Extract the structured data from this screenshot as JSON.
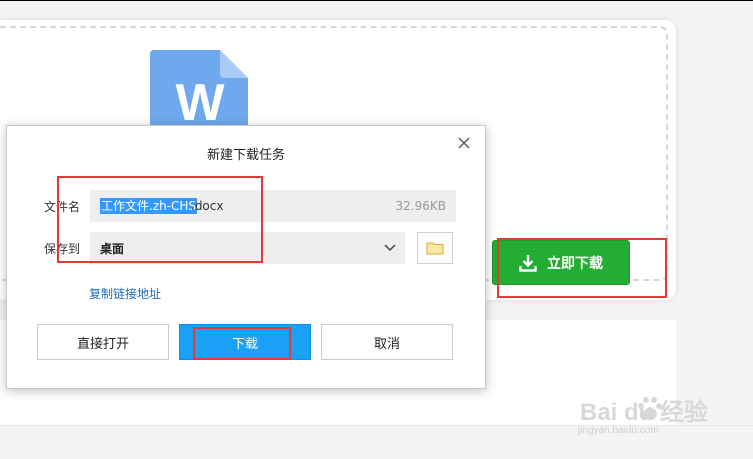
{
  "background": {
    "file_icon_letter": "W",
    "download_now_button": "立即下载"
  },
  "dialog": {
    "title": "新建下载任务",
    "filename_label": "文件名",
    "filename_selected": "工作文件.zh-CHS",
    "filename_extension": ".docx",
    "file_size": "32.96KB",
    "save_to_label": "保存到",
    "save_to_value": "桌面",
    "copy_link": "复制链接地址",
    "buttons": {
      "open": "直接打开",
      "download": "下载",
      "cancel": "取消"
    }
  },
  "watermark": {
    "brand": "Bai du 经验",
    "url": "jingyan.baidu.com"
  },
  "colors": {
    "download_now_green": "#23ad34",
    "download_blue": "#1aa0f5",
    "highlight_red": "#e53935",
    "selection_blue": "#3399ff",
    "link_blue": "#1a6dbb"
  }
}
